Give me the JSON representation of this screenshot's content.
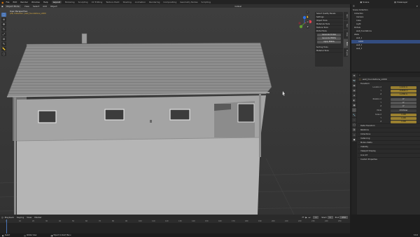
{
  "topbar": {
    "menus": [
      "File",
      "Edit",
      "Render",
      "Window",
      "Help"
    ],
    "workspaces": [
      "Layout",
      "Modeling",
      "Sculpting",
      "UV Editing",
      "Texture Paint",
      "Shading",
      "Animation",
      "Rendering",
      "Compositing",
      "Geometry Nodes",
      "Scripting"
    ],
    "active_workspace": "Layout",
    "scene": "Scene",
    "view_layer": "ViewLayer"
  },
  "viewport_header": {
    "mode": "Object Mode",
    "menus": [
      "View",
      "Select",
      "Add",
      "Object"
    ],
    "orientation": "Global",
    "info_line1": "User Perspective",
    "info_line2": "(25) Collection | wall_foundations_LOD0"
  },
  "toolbar": {
    "tools": [
      "select",
      "cursor",
      "move",
      "rotate",
      "scale",
      "transform",
      "annotate",
      "measure",
      "add-cube"
    ]
  },
  "npanel": {
    "items": [
      "Select Quality Bevels",
      "Settings",
      "Object Tools",
      "Materials Tools",
      "Texture Tools",
      "Portal Tools"
    ],
    "buttons": [
      "Generate Portals",
      "Generate PBRMs",
      "Apply PBRMs"
    ],
    "items2": [
      "Sorting Tools",
      "Material Tools"
    ],
    "tabs": [
      "Item",
      "Tool",
      "View",
      "Edit",
      "Plugins"
    ]
  },
  "outliner": {
    "title": "Scene Collection",
    "rows": [
      {
        "label": "Collection",
        "selected": false
      },
      {
        "label": "Camera",
        "selected": false
      },
      {
        "label": "Cube",
        "selected": false
      },
      {
        "label": "Light",
        "selected": false
      },
      {
        "label": "Portals",
        "selected": false
      },
      {
        "label": "wall_foundations",
        "selected": false
      },
      {
        "label": "Walls",
        "selected": false
      },
      {
        "label": "wall_1",
        "selected": false
      },
      {
        "label": "LOD0",
        "selected": true
      },
      {
        "label": "wall_2",
        "selected": false
      },
      {
        "label": "wall_3",
        "selected": false
      }
    ]
  },
  "properties": {
    "object_name": "wall_foundations_LOD0",
    "transform_title": "Transform",
    "location_label": "Location X",
    "location": [
      "1.0232 m",
      "-6.9526 m",
      "1.2386 m"
    ],
    "rotation_label": "Rotation X",
    "rotation": [
      "0°",
      "0°",
      "0°"
    ],
    "mode_label": "Mode",
    "mode_value": "XYZ Euler",
    "scale_label": "Scale X",
    "scale": [
      "1.000",
      "1.000",
      "1.000"
    ],
    "axis_labels": [
      "X",
      "Y",
      "Z"
    ],
    "sections": [
      "Delta Transform",
      "Relations",
      "Collections",
      "Instancing",
      "Motion Paths",
      "Visibility",
      "Viewport Display",
      "Line Art",
      "Custom Properties"
    ]
  },
  "timeline": {
    "menus": [
      "Playback",
      "Keying",
      "View",
      "Marker"
    ],
    "current_frame": "1",
    "start_label": "Start",
    "start": "1",
    "end_label": "End",
    "end": "250",
    "frames": [
      "0",
      "10",
      "20",
      "30",
      "40",
      "50",
      "60",
      "70",
      "80",
      "90",
      "100",
      "110",
      "120",
      "130",
      "140",
      "150",
      "160",
      "170",
      "180",
      "190",
      "200",
      "210",
      "220",
      "230",
      "240",
      "250"
    ]
  },
  "statusbar": {
    "items": [
      "Select",
      "Rotate View",
      "Object Context Menu"
    ],
    "version": "3.6.0"
  },
  "colors": {
    "accent": "#4772b3",
    "selected_row": "#334d80",
    "field_gold": "#9a8030"
  }
}
